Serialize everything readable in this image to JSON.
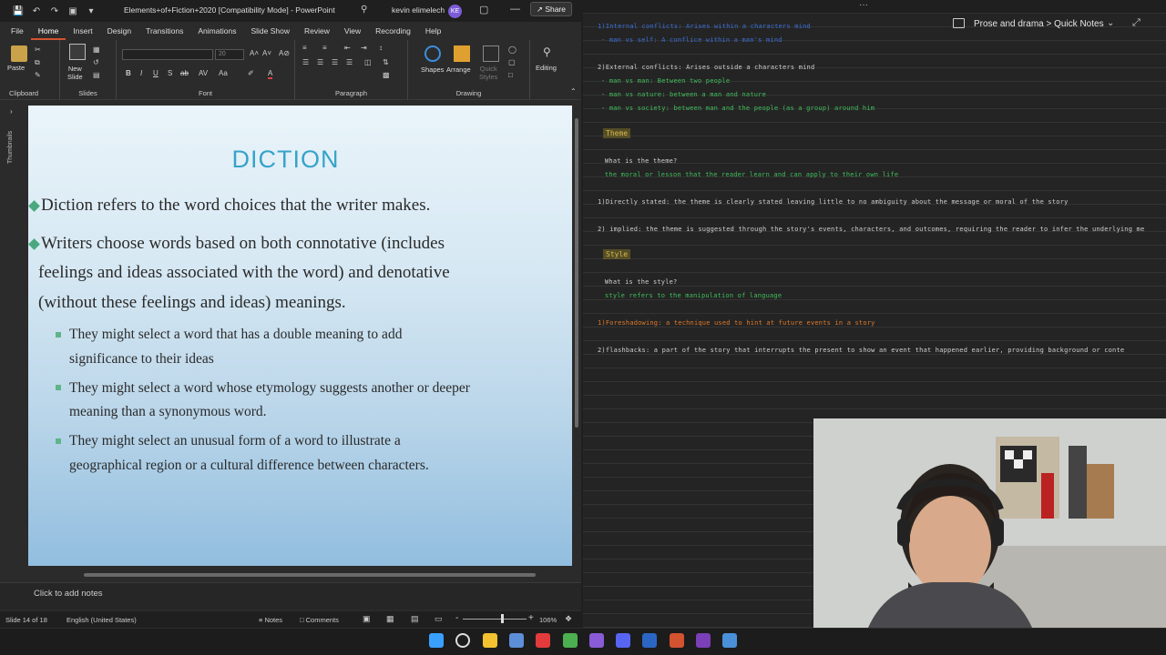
{
  "ppt": {
    "title": "Elements+of+Fiction+2020 [Compatibility Mode] - PowerPoint",
    "user": "kevin elimelech",
    "avatar": "KE",
    "tabs": [
      "File",
      "Home",
      "Insert",
      "Design",
      "Transitions",
      "Animations",
      "Slide Show",
      "Review",
      "View",
      "Recording",
      "Help"
    ],
    "share": "Share",
    "ribbon": {
      "clipboard": "Clipboard",
      "paste": "Paste",
      "slides": "Slides",
      "new_slide": "New\nSlide",
      "font": "Font",
      "paragraph": "Paragraph",
      "drawing": "Drawing",
      "shapes": "Shapes",
      "arrange": "Arrange",
      "quick_styles": "Quick\nStyles",
      "editing": "Editing",
      "font_size": "20"
    },
    "thumbnails_label": "Thumbnails",
    "slide": {
      "title": "DICTION",
      "bullet1": "Diction refers to the word choices that the writer makes.",
      "bullet2_line1": "Writers choose words based on both connotative (includes",
      "bullet2_line2": "feelings and ideas associated with the word) and denotative",
      "bullet2_line3": "(without these feelings and ideas) meanings.",
      "sub1_line1": "They might select a word that has a double meaning to add",
      "sub1_line2": "significance to their ideas",
      "sub2_line1": "They might select a word whose etymology suggests another or deeper",
      "sub2_line2": "meaning than a synonymous word.",
      "sub3_line1": "They might select an unusual form of a word to illustrate a",
      "sub3_line2": "geographical region or a cultural difference between characters."
    },
    "notes_placeholder": "Click to add notes",
    "status": {
      "slide": "Slide 14 of 18",
      "language": "English (United States)",
      "notes": "Notes",
      "comments": "Comments",
      "zoom": "106%",
      "zoom_fraction": 0.6
    }
  },
  "onenote": {
    "breadcrumb": "Prose and drama > Quick Notes",
    "lines": [
      {
        "text": "1)Internal conflicts: Arises within a characters mind",
        "color": "blue"
      },
      {
        "text": "- man vs self: A conflice within a man's mind",
        "color": "blue"
      },
      {
        "text": "2)External conflicts: Arises outside a characters mind",
        "color": "white"
      },
      {
        "text": "- man vs man: Between two people",
        "color": "green"
      },
      {
        "text": "- man vs nature: between a man and nature",
        "color": "green"
      },
      {
        "text": "- man vs society: between man and the people (as a group) around him",
        "color": "green"
      },
      {
        "text": "What is the theme?",
        "color": "white"
      },
      {
        "text": "the moral or lesson that the reader learn and can apply to their own life",
        "color": "green"
      },
      {
        "text": "1)Directly stated: the theme is clearly stated leaving little to no ambiguity about the message or moral of the story",
        "color": "white"
      },
      {
        "text": "2) implied: the theme is suggested through the story's events, characters, and outcomes, requiring the reader to infer the underlying me",
        "color": "white"
      },
      {
        "text": "What is the style?",
        "color": "white"
      },
      {
        "text": "style refers to the manipulation of language",
        "color": "green"
      },
      {
        "text": "1)Foreshadowing: a technique used to hint at future events in a story",
        "color": "orange"
      },
      {
        "text": "2)flashbacks: a part of the story that interrupts the present to show an event that happened earlier, providing background or conte",
        "color": "white"
      }
    ],
    "heading_theme": "Theme",
    "heading_style": "Style"
  },
  "taskbar": {
    "icons": [
      "windows-start-icon",
      "search-icon",
      "file-explorer-icon",
      "photos-icon",
      "opera-icon",
      "chrome-icon",
      "visual-studio-icon",
      "discord-icon",
      "word-icon",
      "powerpoint-icon",
      "onenote-icon",
      "notepad-icon"
    ],
    "colors": [
      "#3aa0ff",
      "#dddddd",
      "#f2c230",
      "#5d8ed8",
      "#e33b3b",
      "#4caf50",
      "#8a5bd6",
      "#5865f2",
      "#2b66c4",
      "#d35230",
      "#7b3fb7",
      "#4a90d9"
    ]
  }
}
